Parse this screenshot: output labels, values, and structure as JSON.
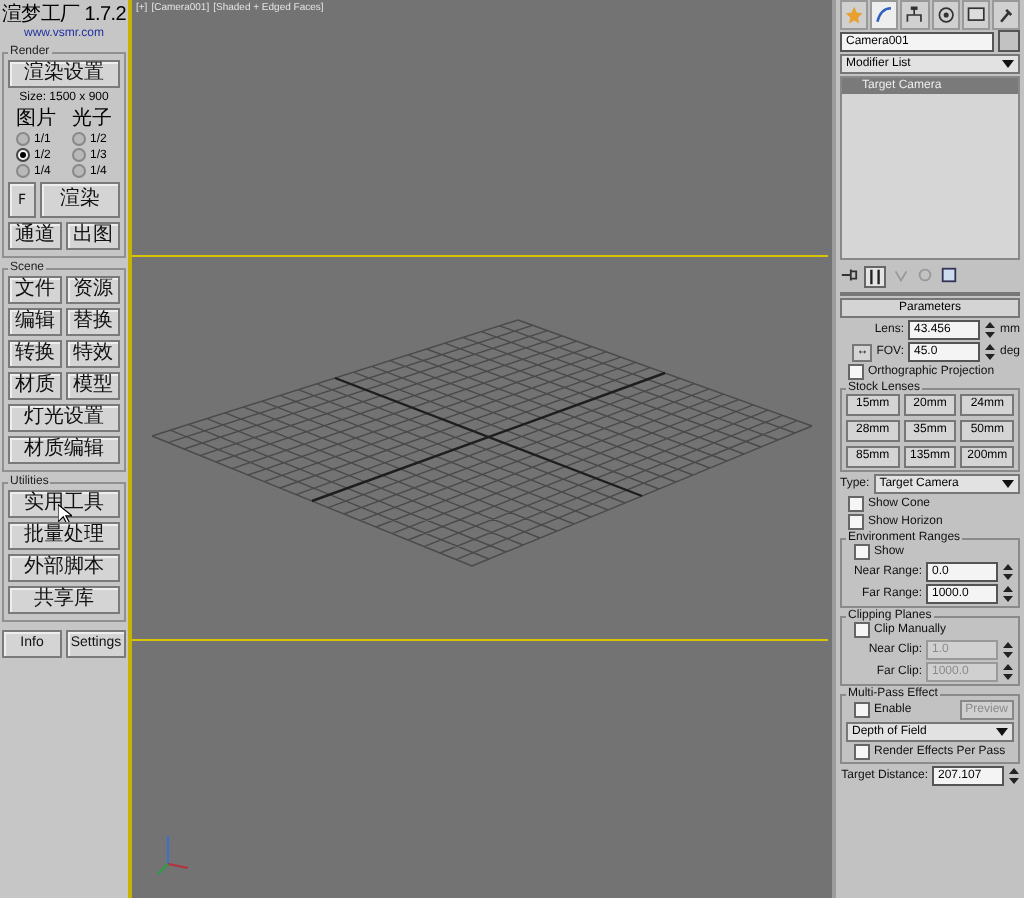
{
  "left_panel": {
    "title": "渲梦工厂 1.7.2",
    "url": "www.vsmr.com",
    "render": {
      "label": "Render",
      "setup_button": "渲染设置",
      "size": "Size: 1500 x 900",
      "columns": [
        {
          "label": "图片",
          "options": [
            {
              "label": "1/1",
              "selected": false
            },
            {
              "label": "1/2",
              "selected": true
            },
            {
              "label": "1/4",
              "selected": false
            }
          ]
        },
        {
          "label": "光子",
          "options": [
            {
              "label": "1/2",
              "selected": false
            },
            {
              "label": "1/3",
              "selected": false
            },
            {
              "label": "1/4",
              "selected": false
            }
          ]
        }
      ],
      "f_button": "F",
      "render_button": "渲染",
      "buttons": [
        "通道",
        "出图"
      ]
    },
    "scene": {
      "label": "Scene",
      "pair_buttons": [
        "文件",
        "资源",
        "编辑",
        "替换",
        "转换",
        "特效",
        "材质",
        "模型"
      ],
      "wide_buttons": [
        "灯光设置",
        "材质编辑"
      ]
    },
    "utilities": {
      "label": "Utilities",
      "buttons": [
        "实用工具",
        "批量处理",
        "外部脚本",
        "共享库"
      ]
    },
    "footer_buttons": [
      "Info",
      "Settings"
    ]
  },
  "viewport": {
    "labels": [
      "[+]",
      "[Camera001]",
      "[Shaded + Edged Faces]"
    ]
  },
  "command_panel": {
    "object_name": "Camera001",
    "modifier_list": "Modifier List",
    "stack": [
      {
        "label": "Target Camera",
        "selected": true
      }
    ],
    "rollout": "Parameters",
    "lens": {
      "label": "Lens:",
      "value": "43.456",
      "unit": "mm"
    },
    "fov": {
      "button": "↔",
      "label": "FOV:",
      "value": "45.0",
      "unit": "deg"
    },
    "orthographic": {
      "label": "Orthographic Projection",
      "checked": false
    },
    "stock_lenses": {
      "label": "Stock Lenses",
      "lenses": [
        "15mm",
        "20mm",
        "24mm",
        "28mm",
        "35mm",
        "50mm",
        "85mm",
        "135mm",
        "200mm"
      ]
    },
    "type": {
      "label": "Type:",
      "value": "Target Camera"
    },
    "show_cone": {
      "label": "Show Cone",
      "checked": false
    },
    "show_horizon": {
      "label": "Show Horizon",
      "checked": false
    },
    "environment_ranges": {
      "label": "Environment Ranges",
      "show": {
        "label": "Show",
        "checked": false
      },
      "fields": [
        {
          "label": "Near Range:",
          "value": "0.0",
          "disabled": false
        },
        {
          "label": "Far Range:",
          "value": "1000.0",
          "disabled": false
        }
      ]
    },
    "clipping_planes": {
      "label": "Clipping Planes",
      "clip_manually": {
        "label": "Clip Manually",
        "checked": false
      },
      "fields": [
        {
          "label": "Near Clip:",
          "value": "1.0",
          "disabled": true
        },
        {
          "label": "Far Clip:",
          "value": "1000.0",
          "disabled": true
        }
      ]
    },
    "multi_pass": {
      "label": "Multi-Pass Effect",
      "enable": {
        "label": "Enable",
        "checked": false
      },
      "preview": {
        "label": "Preview",
        "disabled": true
      },
      "effect": "Depth of Field",
      "render_per_pass": {
        "label": "Render Effects Per Pass",
        "checked": false
      }
    },
    "target_distance": {
      "label": "Target Distance:",
      "value": "207.107"
    }
  }
}
